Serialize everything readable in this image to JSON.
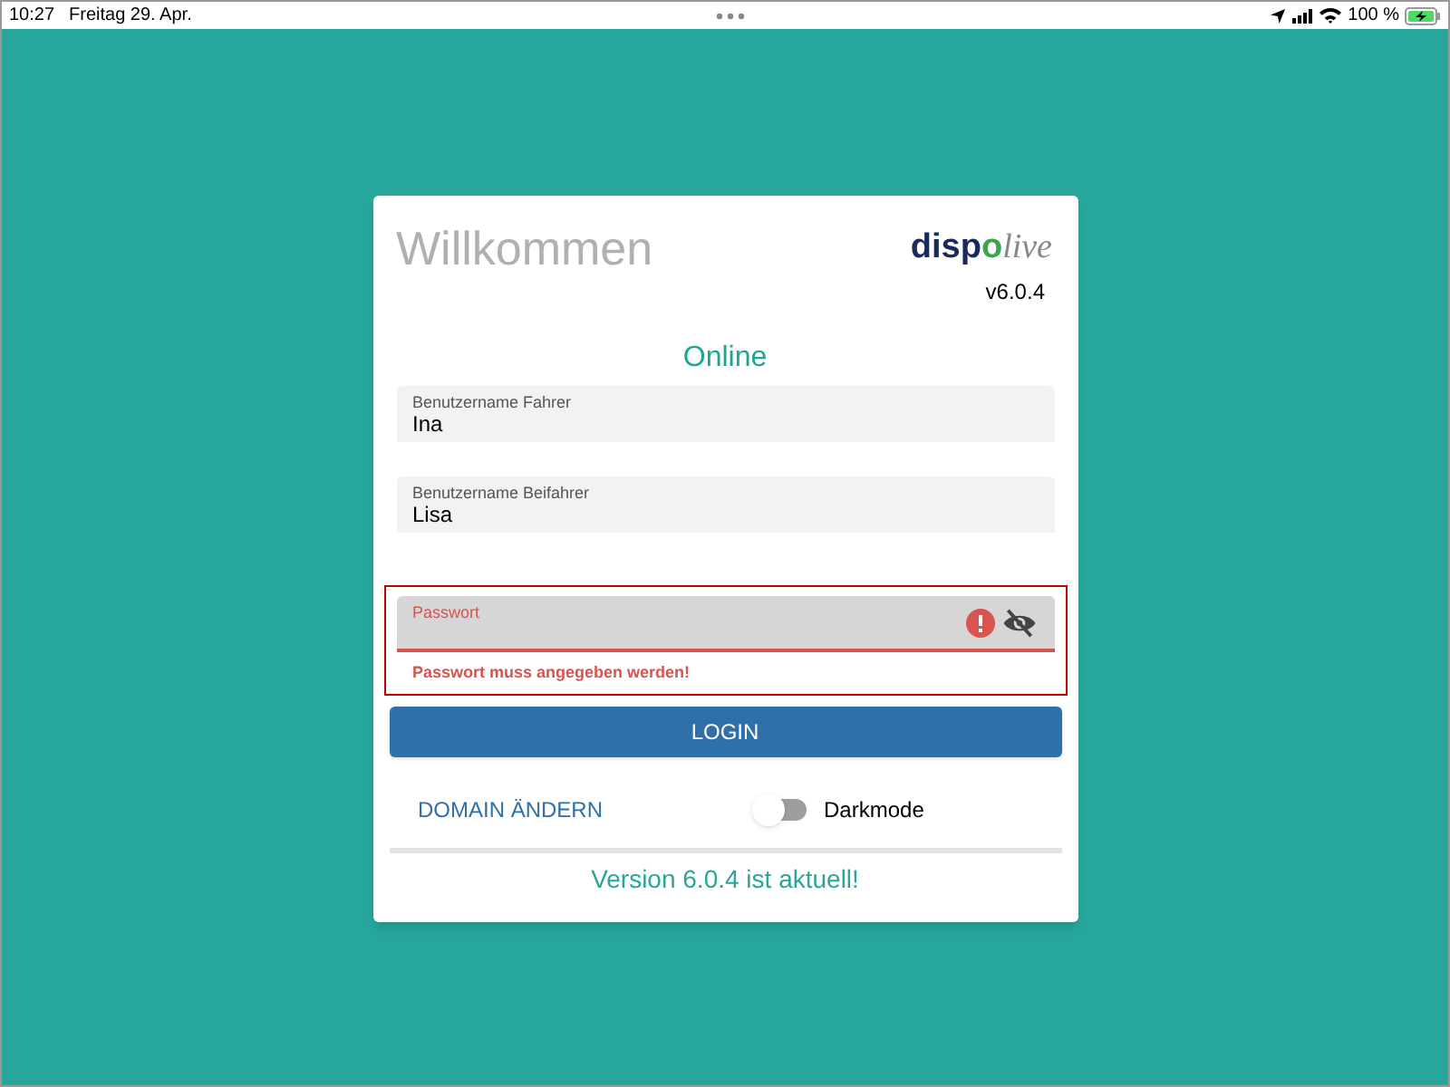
{
  "status_bar": {
    "time": "10:27",
    "date": "Freitag 29. Apr.",
    "battery": "100 %"
  },
  "card": {
    "title": "Willkommen",
    "logo": {
      "part_1": "disp",
      "part_2": "o",
      "part_3": "live"
    },
    "version": "v6.0.4",
    "connection": "Online",
    "fields": [
      {
        "label": "Benutzername Fahrer",
        "value": "Ina",
        "error": false,
        "kind": "text"
      },
      {
        "label": "Benutzername Beifahrer",
        "value": "Lisa",
        "error": false,
        "kind": "text"
      },
      {
        "label": "Passwort",
        "error": true,
        "kind": "password",
        "error_text": "Passwort muss angegeben werden!"
      }
    ],
    "login_button": "LOGIN",
    "domain_link": "DOMAIN ÄNDERN",
    "darkmode": {
      "label": "Darkmode",
      "on": false
    },
    "update_status": "Version 6.0.4 ist aktuell!"
  }
}
